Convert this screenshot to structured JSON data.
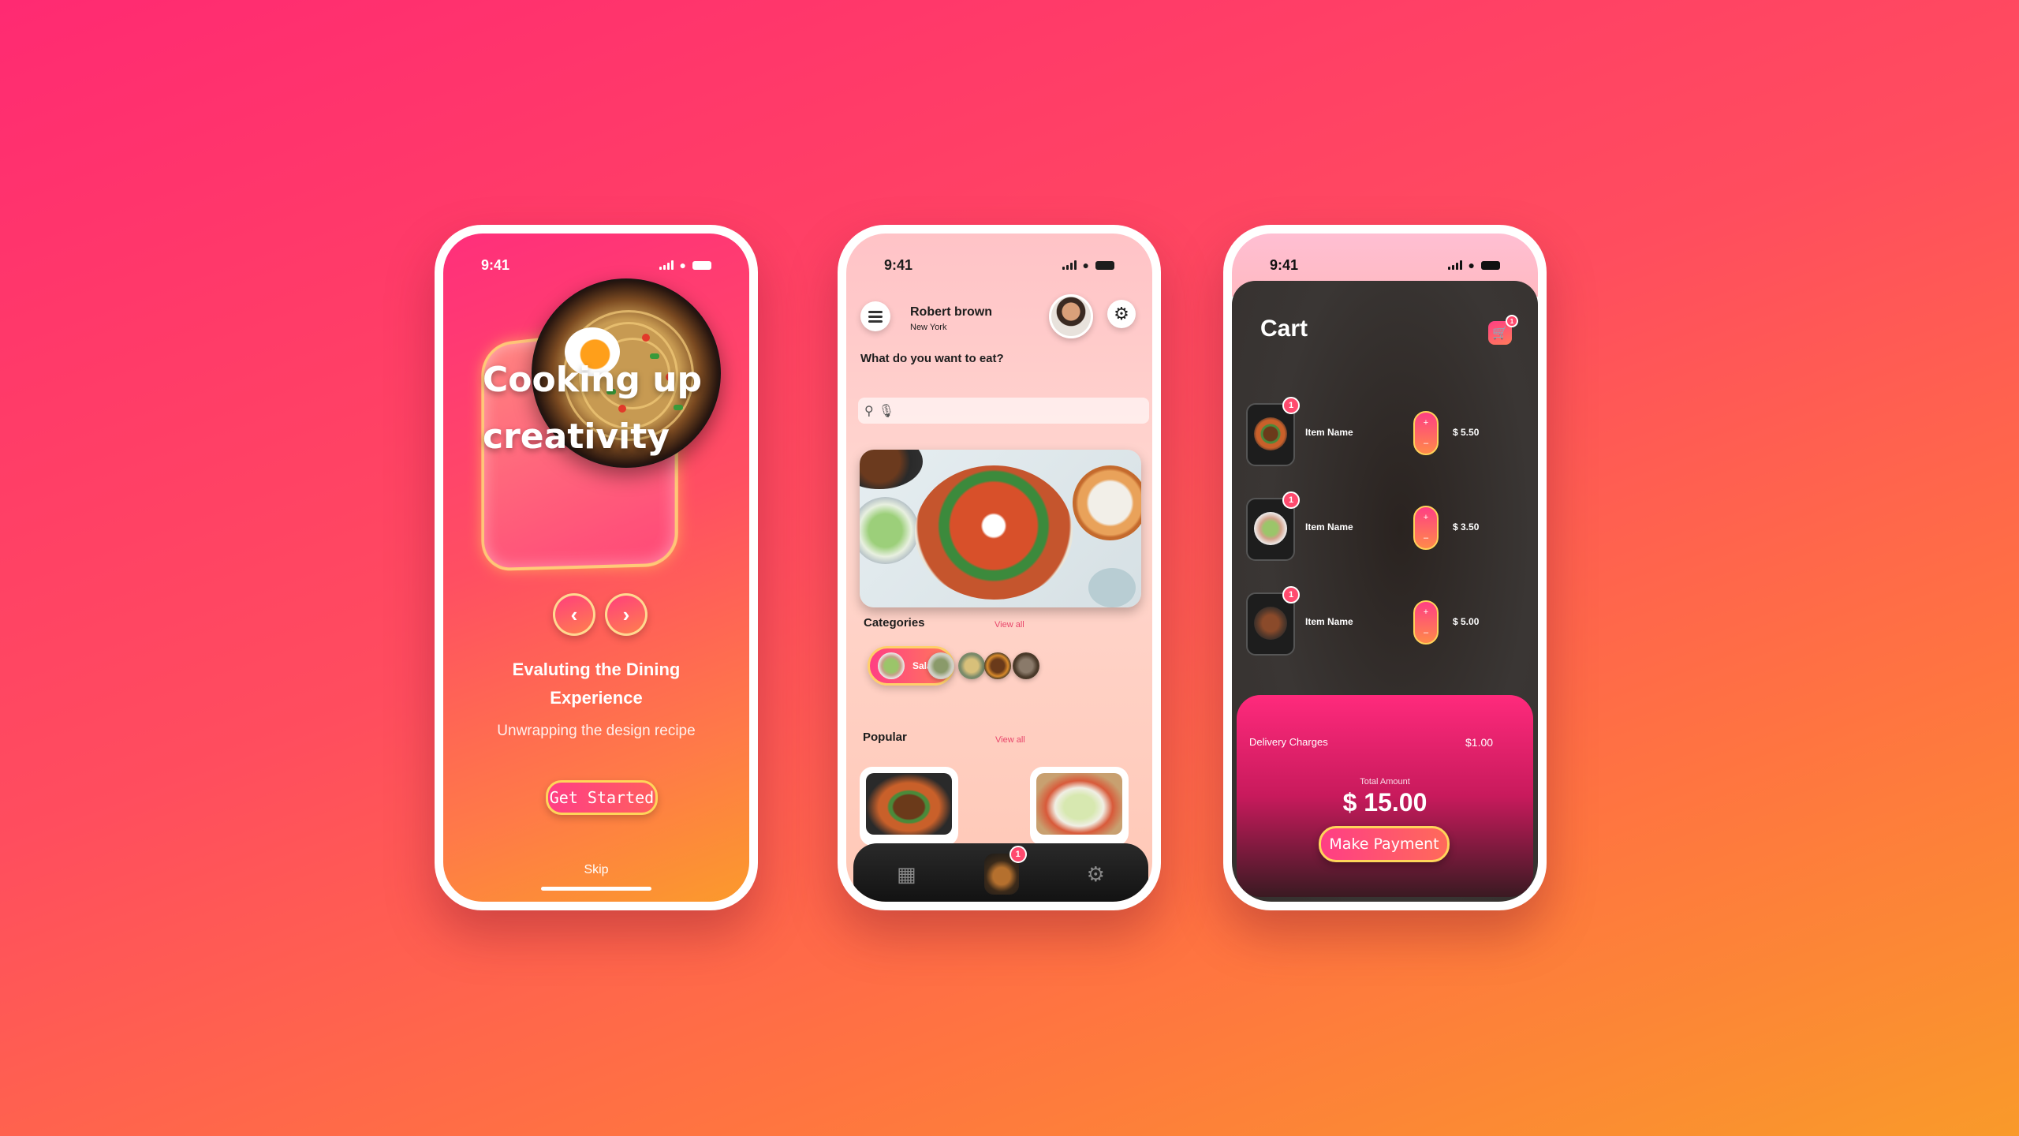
{
  "status_bar": {
    "time": "9:41"
  },
  "onboarding": {
    "hero_line1": "Cooking up",
    "hero_line2": "creativity",
    "prev_icon": "chevron-left-icon",
    "next_icon": "chevron-right-icon",
    "title_line1": "Evaluting the Dining",
    "title_line2": "Experience",
    "subtitle": "Unwrapping the design recipe",
    "cta_label": "Get Started",
    "skip_label": "Skip"
  },
  "home": {
    "user_name": "Robert brown",
    "user_city": "New York",
    "question": "What do you want to eat?",
    "categories_title": "Categories",
    "categories_view_all": "View all",
    "active_category": "Salad",
    "popular_title": "Popular",
    "popular_view_all": "View all",
    "cart_badge": "1"
  },
  "cart": {
    "title": "Cart",
    "cart_icon_badge": "1",
    "items": [
      {
        "name": "Item Name",
        "price": "$ 5.50",
        "badge": "1"
      },
      {
        "name": "Item Name",
        "price": "$ 3.50",
        "badge": "1"
      },
      {
        "name": "Item Name",
        "price": "$ 5.00",
        "badge": "1"
      }
    ],
    "delivery_label": "Delivery Charges",
    "delivery_value": "$1.00",
    "total_label": "Total Amount",
    "total_value": "$ 15.00",
    "pay_label": "Make Payment"
  },
  "colors": {
    "accent_pink": "#ff3f84",
    "accent_orange": "#ff7a48",
    "accent_gold": "#ffd55a"
  }
}
